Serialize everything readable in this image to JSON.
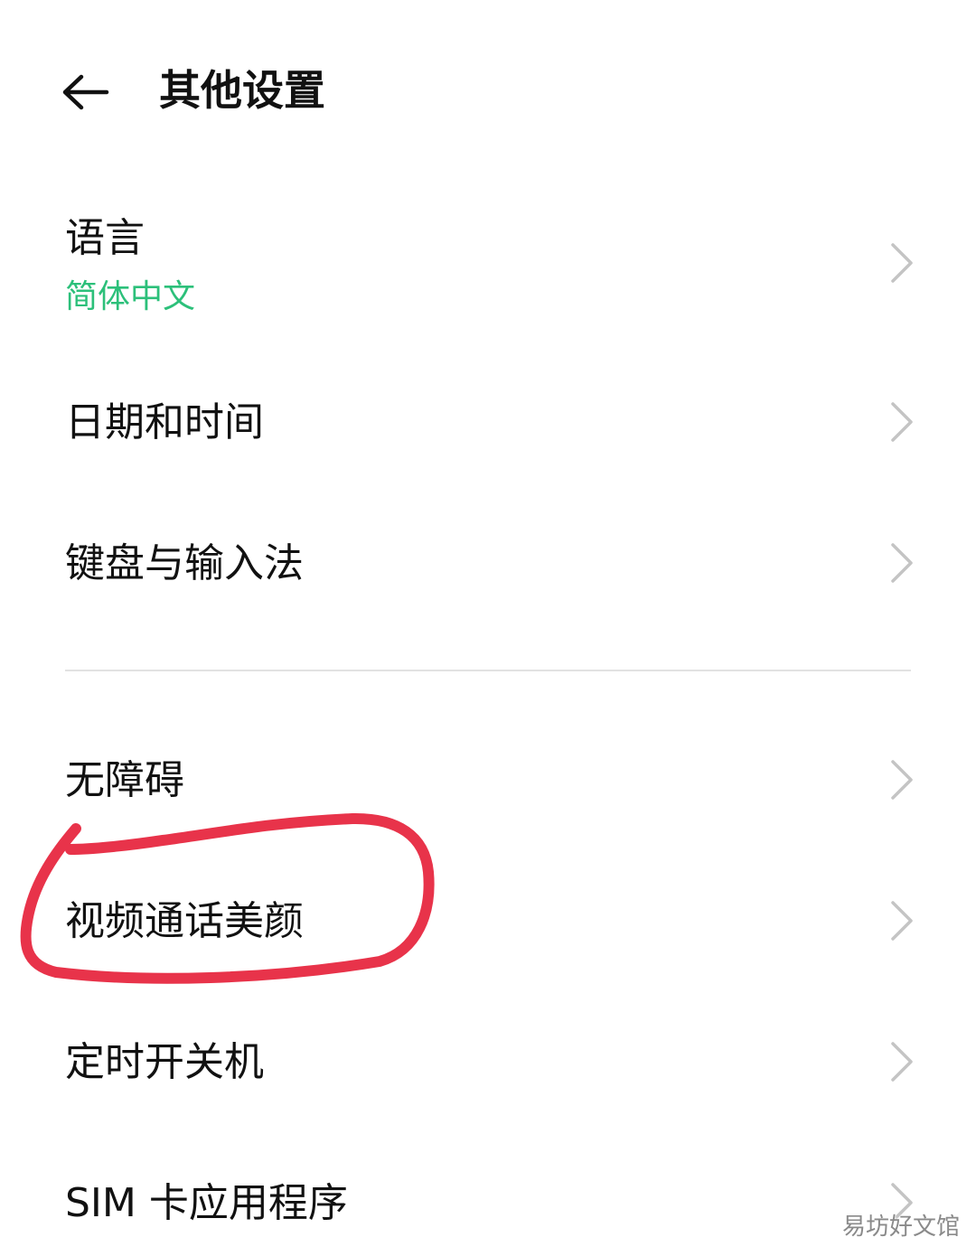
{
  "header": {
    "back_icon": "arrow-left-icon",
    "title": "其他设置"
  },
  "settings": {
    "items": [
      {
        "label": "语言",
        "value": "简体中文",
        "icon": "chevron-right-icon"
      },
      {
        "label": "日期和时间",
        "icon": "chevron-right-icon"
      },
      {
        "label": "键盘与输入法",
        "icon": "chevron-right-icon"
      },
      {
        "label": "无障碍",
        "icon": "chevron-right-icon"
      },
      {
        "label": "视频通话美颜",
        "icon": "chevron-right-icon"
      },
      {
        "label": "定时开关机",
        "icon": "chevron-right-icon"
      },
      {
        "label": "SIM 卡应用程序",
        "icon": "chevron-right-icon"
      }
    ]
  },
  "annotation": {
    "shape": "hand-drawn-circle",
    "color": "#e8334a",
    "target": "视频通话美颜"
  },
  "colors": {
    "accent": "#2cc07a",
    "chevron": "#c4c4c4",
    "divider": "#e2e2e2"
  },
  "watermark": {
    "text": "易坊好文馆"
  }
}
